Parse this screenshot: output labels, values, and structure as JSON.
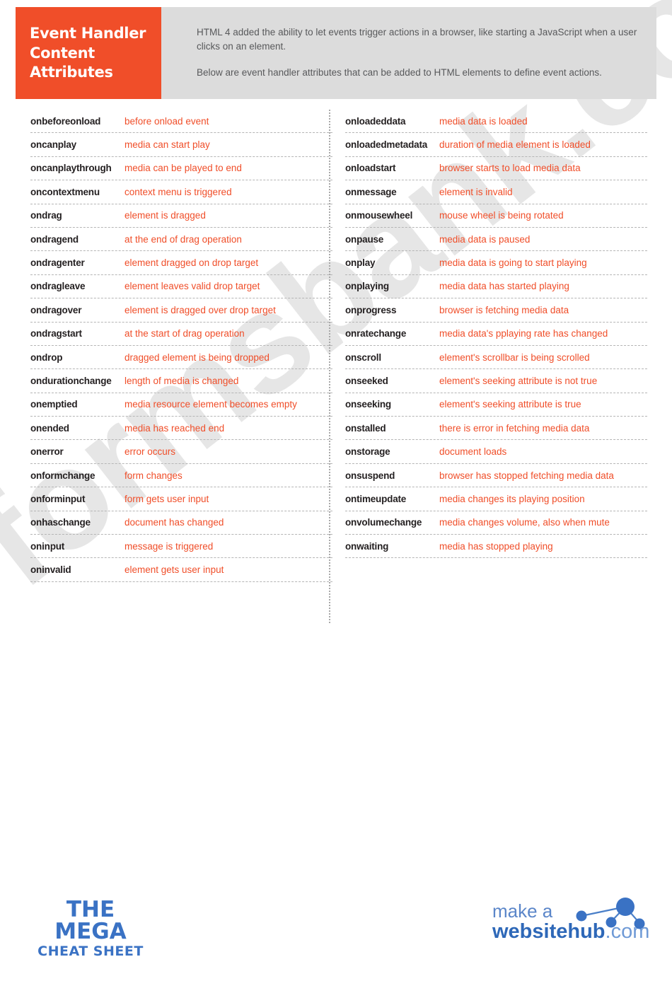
{
  "header": {
    "title": "Event Handler Content Attributes",
    "paragraphs": [
      "HTML 4 added the ability to let events trigger actions in a browser, like starting a JavaScript when a user clicks on an element.",
      "Below are event handler attributes that can be added to HTML elements to define event actions."
    ]
  },
  "colors": {
    "accent": "#f04e29",
    "header_panel": "#dcdcdc",
    "attribute_text": "#231f20",
    "brand_blue": "#3a72c4",
    "watermark": "#e6e6e6"
  },
  "watermark": {
    "text": "formsbank.com"
  },
  "left_column": [
    {
      "attribute": "onbeforeonload",
      "description": "before onload event"
    },
    {
      "attribute": "oncanplay",
      "description": "media can start play"
    },
    {
      "attribute": "oncanplaythrough",
      "description": "media can be played to end"
    },
    {
      "attribute": "oncontextmenu",
      "description": "context menu is triggered"
    },
    {
      "attribute": "ondrag",
      "description": "element is dragged"
    },
    {
      "attribute": "ondragend",
      "description": "at the end of drag operation"
    },
    {
      "attribute": "ondragenter",
      "description": "element dragged on drop target"
    },
    {
      "attribute": "ondragleave",
      "description": "element leaves valid drop target"
    },
    {
      "attribute": "ondragover",
      "description": "element is dragged over drop target"
    },
    {
      "attribute": "ondragstart",
      "description": "at the start of drag operation"
    },
    {
      "attribute": "ondrop",
      "description": "dragged element is being dropped"
    },
    {
      "attribute": "ondurationchange",
      "description": "length of media is changed"
    },
    {
      "attribute": "onemptied",
      "description": "media resource element becomes empty"
    },
    {
      "attribute": "onended",
      "description": "media has reached end"
    },
    {
      "attribute": "onerror",
      "description": "error occurs"
    },
    {
      "attribute": "onformchange",
      "description": "form changes"
    },
    {
      "attribute": "onforminput",
      "description": "form gets user input"
    },
    {
      "attribute": "onhaschange",
      "description": "document has changed"
    },
    {
      "attribute": "oninput",
      "description": "message is triggered"
    },
    {
      "attribute": "oninvalid",
      "description": "element gets user input"
    }
  ],
  "right_column": [
    {
      "attribute": "onloadeddata",
      "description": "media data is loaded"
    },
    {
      "attribute": "onloadedmetadata",
      "description": "duration of media element is loaded"
    },
    {
      "attribute": "onloadstart",
      "description": "browser starts to load media data"
    },
    {
      "attribute": "onmessage",
      "description": "element is invalid"
    },
    {
      "attribute": "onmousewheel",
      "description": "mouse wheel is being rotated"
    },
    {
      "attribute": "onpause",
      "description": "media data is paused"
    },
    {
      "attribute": "onplay",
      "description": "media data is going to start playing"
    },
    {
      "attribute": "onplaying",
      "description": "media data has started playing"
    },
    {
      "attribute": "onprogress",
      "description": "browser is fetching media data"
    },
    {
      "attribute": "onratechange",
      "description": "media data's pplaying rate has changed"
    },
    {
      "attribute": "onscroll",
      "description": "element's scrollbar is being scrolled"
    },
    {
      "attribute": "onseeked",
      "description": "element's seeking attribute is not true"
    },
    {
      "attribute": "onseeking",
      "description": "element's seeking attribute is true"
    },
    {
      "attribute": "onstalled",
      "description": "there is error in fetching media data"
    },
    {
      "attribute": "onstorage",
      "description": "document loads"
    },
    {
      "attribute": "onsuspend",
      "description": "browser has stopped fetching media data"
    },
    {
      "attribute": "ontimeupdate",
      "description": "media changes its playing position"
    },
    {
      "attribute": "onvolumechange",
      "description": "media changes volume, also when mute"
    },
    {
      "attribute": "onwaiting",
      "description": "media has stopped playing"
    }
  ],
  "footer": {
    "mega_line1": "THE MEGA",
    "mega_line2": "CHEAT SHEET",
    "hub_make": "make a",
    "hub_name": "websitehub",
    "hub_tld": ".com"
  }
}
